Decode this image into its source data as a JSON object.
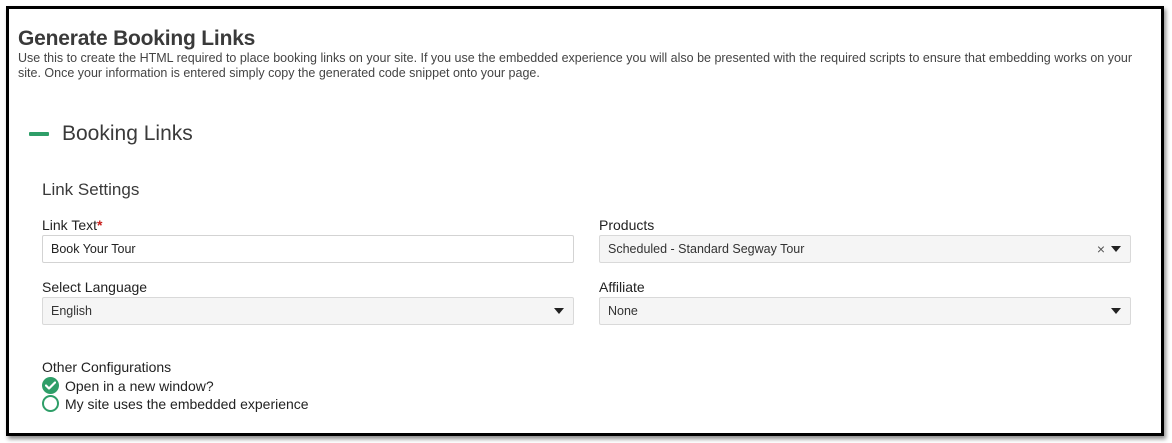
{
  "page": {
    "title": "Generate Booking Links",
    "description": "Use this to create the HTML required to place booking links on your site. If you use the embedded experience you will also be presented with the required scripts to ensure that embedding works on your site. Once your information is entered simply copy the generated code snippet onto your page."
  },
  "section": {
    "title": "Booking Links",
    "collapse_icon": "minus-icon"
  },
  "link_settings": {
    "title": "Link Settings",
    "link_text": {
      "label": "Link Text",
      "required_mark": "*",
      "value": "Book Your Tour"
    },
    "products": {
      "label": "Products",
      "selected": "Scheduled - Standard Segway Tour",
      "clear_glyph": "×"
    },
    "language": {
      "label": "Select Language",
      "selected": "English"
    },
    "affiliate": {
      "label": "Affiliate",
      "selected": "None"
    }
  },
  "other_config": {
    "title": "Other Configurations",
    "options": [
      {
        "label": "Open in a new window?",
        "checked": true
      },
      {
        "label": "My site uses the embedded experience",
        "checked": false
      }
    ]
  },
  "colors": {
    "accent": "#2e9e68",
    "required": "#c8201d"
  }
}
